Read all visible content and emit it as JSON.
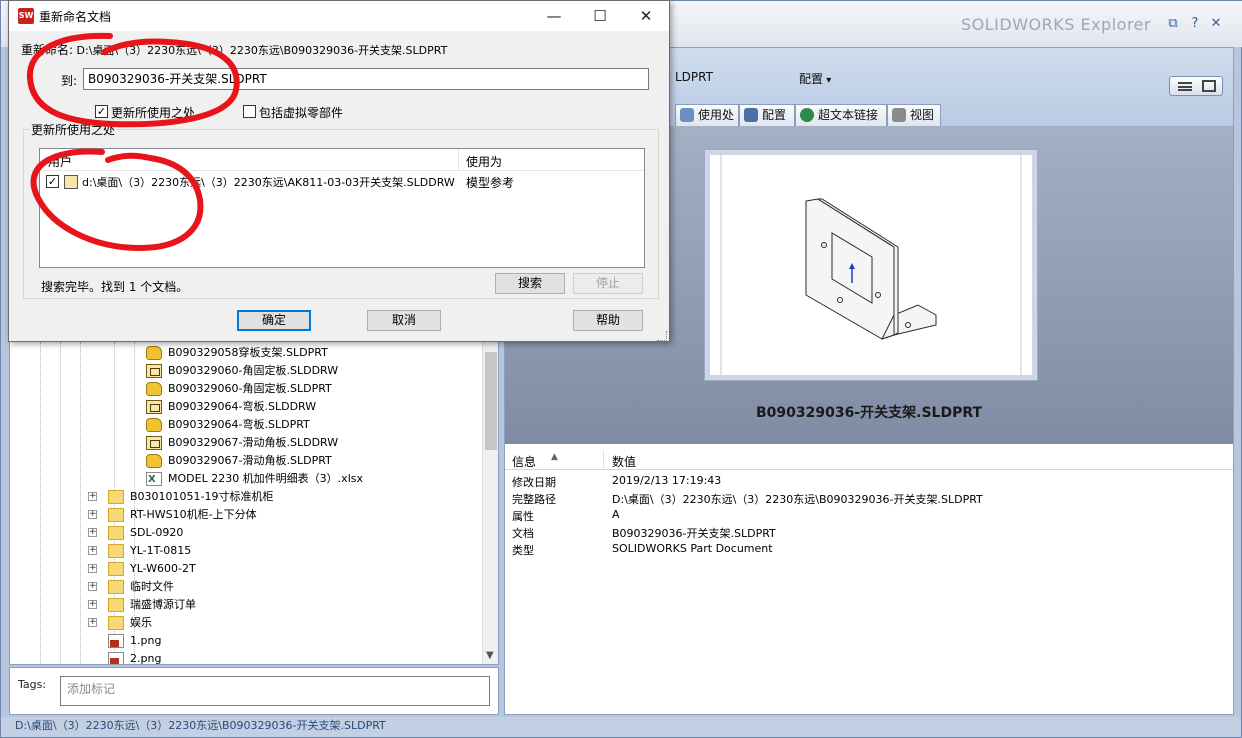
{
  "app": {
    "title": "SOLIDWORKS Explorer",
    "window_controls": [
      "⧉",
      "?",
      "✕"
    ]
  },
  "right": {
    "filename": "LDPRT",
    "config_label": "配置",
    "tabs": [
      {
        "label": "使用处",
        "icon": "where-used-icon"
      },
      {
        "label": "配置",
        "icon": "configurations-icon"
      },
      {
        "label": "超文本链接",
        "icon": "hyperlink-icon"
      },
      {
        "label": "视图",
        "icon": "view-icon"
      }
    ],
    "preview_name": "B090329036-开关支架.SLDPRT",
    "info": {
      "col_info": "信息",
      "col_value": "数值",
      "rows": [
        {
          "key": "修改日期",
          "value": "2019/2/13 17:19:43"
        },
        {
          "key": "完整路径",
          "value": "D:\\桌面\\（3）2230东远\\（3）2230东远\\B090329036-开关支架.SLDPRT"
        },
        {
          "key": "属性",
          "value": "A"
        },
        {
          "key": "文档",
          "value": "B090329036-开关支架.SLDPRT"
        },
        {
          "key": "类型",
          "value": "SOLIDWORKS Part Document"
        }
      ]
    }
  },
  "tree": {
    "files": [
      {
        "label": "B090329058穿板支架.SLDPRT",
        "icon": "part"
      },
      {
        "label": "B090329060-角固定板.SLDDRW",
        "icon": "drw"
      },
      {
        "label": "B090329060-角固定板.SLDPRT",
        "icon": "part"
      },
      {
        "label": "B090329064-弯板.SLDDRW",
        "icon": "drw"
      },
      {
        "label": "B090329064-弯板.SLDPRT",
        "icon": "part"
      },
      {
        "label": "B090329067-滑动角板.SLDDRW",
        "icon": "drw"
      },
      {
        "label": "B090329067-滑动角板.SLDPRT",
        "icon": "part"
      },
      {
        "label": "MODEL 2230 机加件明细表（3）.xlsx",
        "icon": "xlsx"
      }
    ],
    "folders": [
      "B030101051-19寸标准机柜",
      "RT-HWS10机柜-上下分体",
      "SDL-0920",
      "YL-1T-0815",
      "YL-W600-2T",
      "临时文件",
      "瑞盛博源订单",
      "娱乐"
    ],
    "images": [
      "1.png",
      "2.png"
    ]
  },
  "tags": {
    "label": "Tags:",
    "placeholder": "添加标记"
  },
  "statusbar": "D:\\桌面\\（3）2230东远\\（3）2230东远\\B090329036-开关支架.SLDPRT",
  "dialog": {
    "title": "重新命名文档",
    "rename_label": "重新命名:",
    "rename_path": "D:\\桌面\\（3）2230东远\\（3）2230东远\\B090329036-开关支架.SLDPRT",
    "to_label": "到:",
    "to_value": "B090329036-开关支架.SLDPRT",
    "update_where_used": "更新所使用之处",
    "include_virtual": "包括虚拟零部件",
    "group_title": "更新所使用之处",
    "col_user": "用户",
    "col_used_as": "使用为",
    "row_path": "d:\\桌面\\（3）2230东远\\（3）2230东远\\AK811-03-03开关支架.SLDDRW",
    "row_used_as": "模型参考",
    "search_status": "搜索完毕。找到 1 个文档。",
    "search_button": "搜索",
    "stop_button": "停止",
    "ok_button": "确定",
    "cancel_button": "取消",
    "help_button": "帮助"
  },
  "colors": {
    "annotation_red": "#e8141b",
    "accent_blue": "#0078d7"
  }
}
